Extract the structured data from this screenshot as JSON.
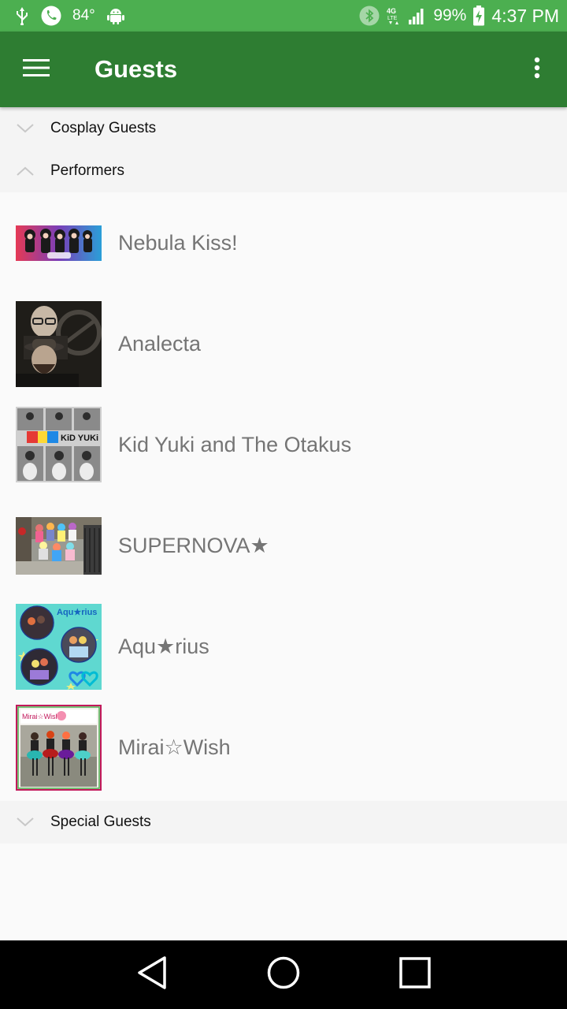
{
  "status_bar": {
    "temperature": "84°",
    "network_type": "4G LTE",
    "battery": "99%",
    "time": "4:37 PM"
  },
  "app_bar": {
    "title": "Guests"
  },
  "sections": [
    {
      "label": "Cosplay Guests",
      "expanded": false
    },
    {
      "label": "Performers",
      "expanded": true
    },
    {
      "label": "Special Guests",
      "expanded": false
    }
  ],
  "performers": [
    {
      "name": "Nebula Kiss!"
    },
    {
      "name": "Analecta"
    },
    {
      "name": "Kid Yuki and The Otakus"
    },
    {
      "name": "SUPERNOVA★"
    },
    {
      "name": "Aqu★rius"
    },
    {
      "name": "Mirai☆Wish"
    }
  ],
  "thumb_text": {
    "kid_yuki": "KiD YUKi",
    "aquarius": "Aqu★rius",
    "mirai": "Mirai☆Wish"
  },
  "colors": {
    "status_bar": "#4caf50",
    "app_bar": "#2e7d32",
    "section_bg": "#f4f4f4",
    "guest_text": "#757575"
  }
}
